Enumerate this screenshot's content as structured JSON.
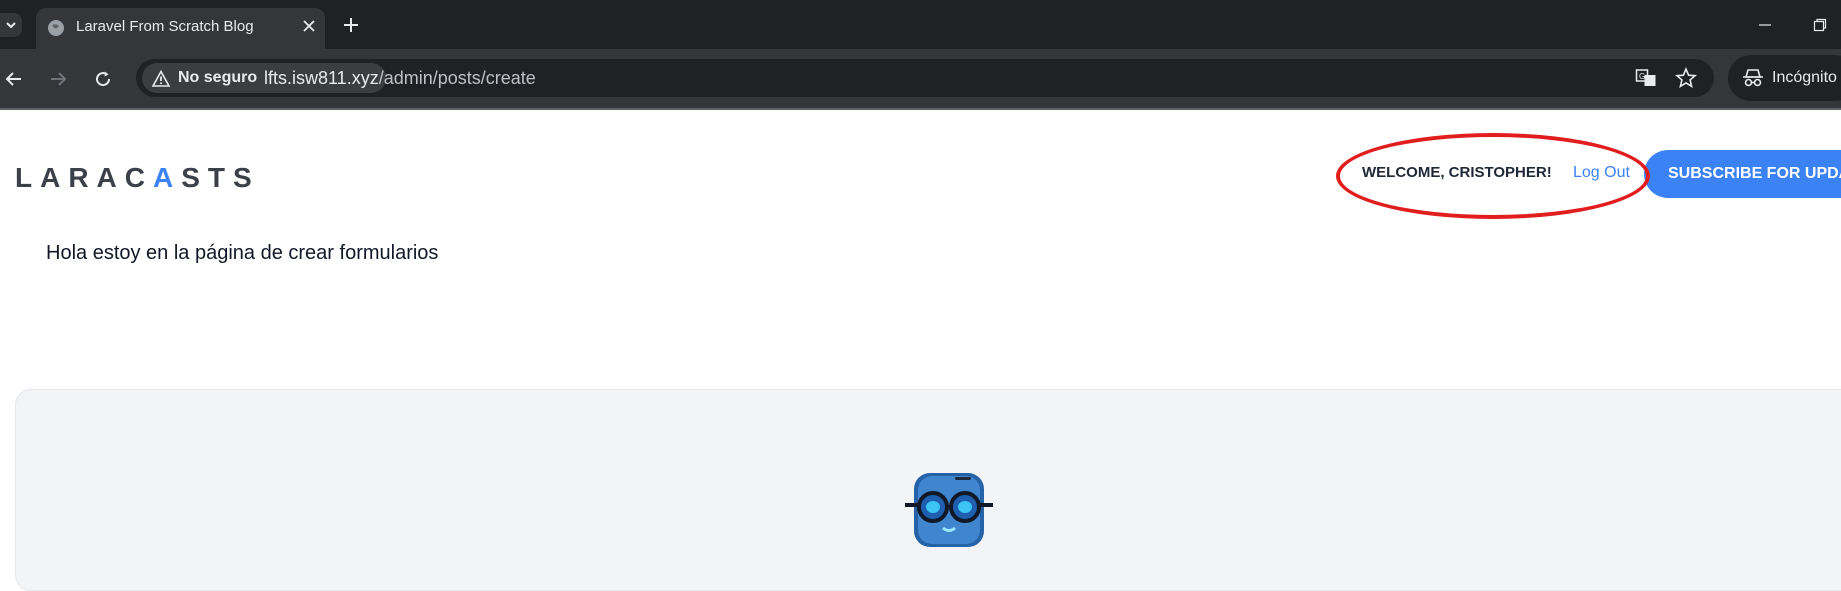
{
  "browser": {
    "tab": {
      "title": "Laravel From Scratch Blog"
    },
    "security_chip": "No seguro",
    "url": {
      "host": "lfts.isw811.xyz",
      "path": "/admin/posts/create"
    },
    "profile_label": "Incógnito",
    "icons": [
      "tab-list-icon",
      "globe-icon",
      "close-icon",
      "plus-icon",
      "minimize-icon",
      "restore-icon",
      "back-icon",
      "forward-icon",
      "reload-icon",
      "warning-icon",
      "translate-icon",
      "star-icon",
      "incognito-icon"
    ]
  },
  "page": {
    "logo": {
      "pre": "LARAC",
      "hat": "A",
      "post": "STS"
    },
    "nav": {
      "welcome": "WELCOME, CRISTOPHER!",
      "logout": "Log Out",
      "subscribe": "SUBSCRIBE FOR UPDATES"
    },
    "intro_text": "Hola estoy en la página de crear formularios",
    "colors": {
      "accent": "#3b82f6",
      "annotation": "#e11d1d"
    }
  }
}
